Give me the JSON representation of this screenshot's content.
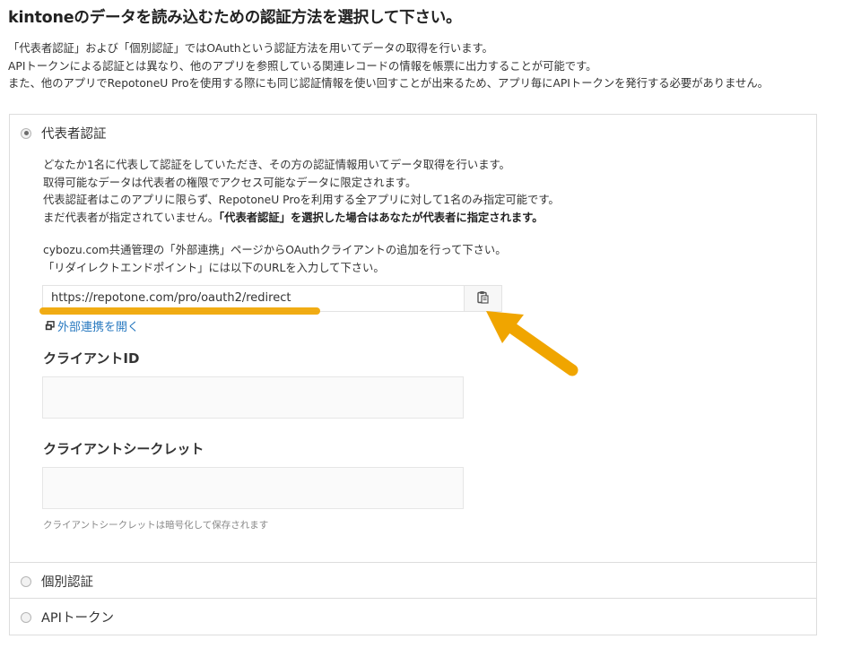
{
  "page": {
    "title": "kintoneのデータを読み込むための認証方法を選択して下さい。",
    "intro": [
      "「代表者認証」および「個別認証」ではOAuthという認証方法を用いてデータの取得を行います。",
      "APIトークンによる認証とは異なり、他のアプリを参照している関連レコードの情報を帳票に出力することが可能です。",
      "また、他のアプリでRepotoneU Proを使用する際にも同じ認証情報を使い回すことが出来るため、アプリ毎にAPIトークンを発行する必要がありません。"
    ]
  },
  "auth_options": {
    "representative": {
      "label": "代表者認証",
      "selected": true,
      "desc": [
        "どなたか1名に代表して認証をしていただき、その方の認証情報用いてデータ取得を行います。",
        "取得可能なデータは代表者の権限でアクセス可能なデータに限定されます。",
        "代表認証者はこのアプリに限らず、RepotoneU Proを利用する全アプリに対して1名のみ指定可能です。"
      ],
      "desc_last_plain": "まだ代表者が指定されていません。",
      "desc_last_bold": "「代表者認証」を選択した場合はあなたが代表者に指定されます。",
      "instructions": [
        "cybozu.com共通管理の「外部連携」ページからOAuthクライアントの追加を行って下さい。",
        "「リダイレクトエンドポイント」には以下のURLを入力して下さい。"
      ],
      "redirect_url": "https://repotone.com/pro/oauth2/redirect",
      "open_external_link": "外部連携を開く",
      "client_id_label": "クライアントID",
      "client_id_value": "",
      "client_secret_label": "クライアントシークレット",
      "client_secret_value": "",
      "client_secret_note": "クライアントシークレットは暗号化して保存されます"
    },
    "individual": {
      "label": "個別認証",
      "selected": false
    },
    "api_token": {
      "label": "APIトークン",
      "selected": false
    }
  },
  "icons": {
    "copy": "clipboard-icon",
    "external": "external-window-icon",
    "annotation": "arrow-icon"
  },
  "colors": {
    "link": "#2a7ac0",
    "highlight": "#f0a500",
    "border": "#dddddd"
  }
}
